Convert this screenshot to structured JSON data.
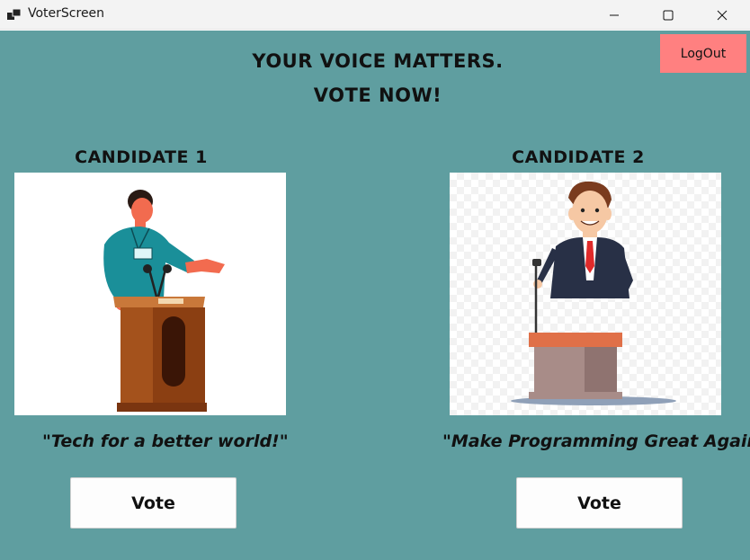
{
  "window": {
    "title": "VoterScreen",
    "icon": "app-window-icon"
  },
  "header": {
    "line1": "YOUR VOICE MATTERS.",
    "line2": "VOTE NOW!"
  },
  "logout_label": "LogOut",
  "candidates": [
    {
      "title": "CANDIDATE 1",
      "slogan": "\"Tech for a better world!\"",
      "vote_label": "Vote",
      "image_icon": "speaker-at-podium-illustration"
    },
    {
      "title": "CANDIDATE 2",
      "slogan": "\"Make Programming Great Again\"",
      "vote_label": "Vote",
      "image_icon": "businessman-at-podium-illustration"
    }
  ],
  "colors": {
    "background": "#5f9ea0",
    "logout_button": "#ff8080",
    "vote_button": "#fdfdfd"
  }
}
